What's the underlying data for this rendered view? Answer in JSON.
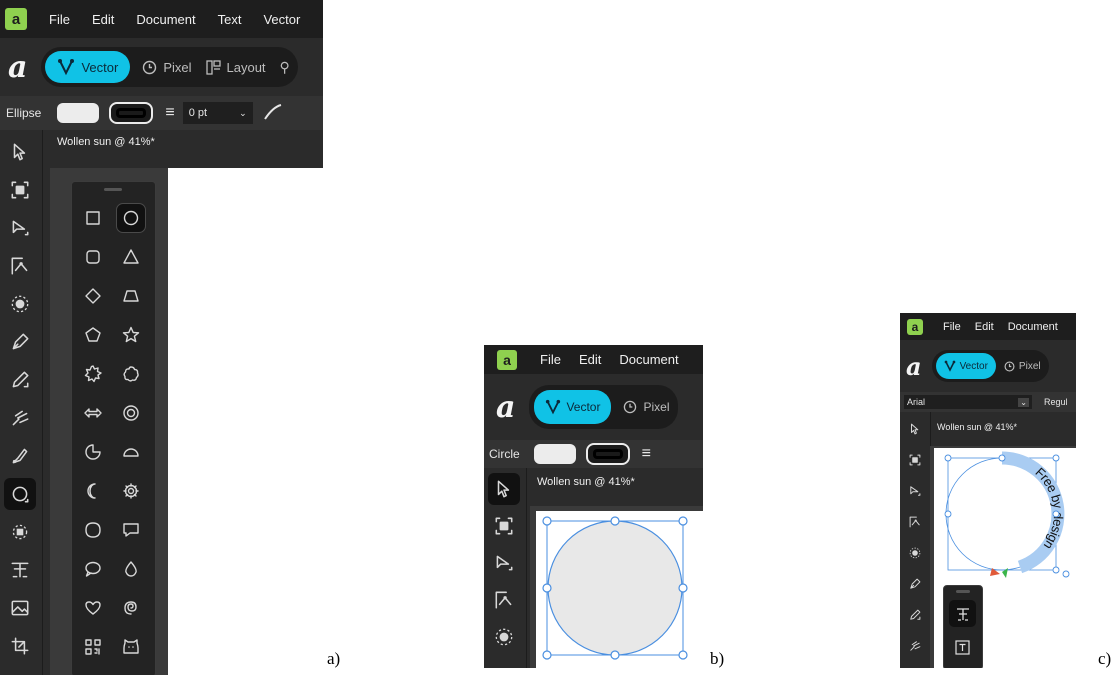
{
  "panel_a": {
    "menu": [
      "File",
      "Edit",
      "Document",
      "Text",
      "Vector"
    ],
    "personas": {
      "vector": "Vector",
      "pixel": "Pixel",
      "layout": "Layout"
    },
    "context_tool": "Ellipse",
    "stroke_width": "0 pt",
    "doc_title": "Wollen sun @ 41%*",
    "tools": [
      "move-icon",
      "frame-icon",
      "node-icon",
      "corner-icon",
      "fill-icon",
      "pen-icon",
      "pencil-icon",
      "brush-icon",
      "vector-brush-icon",
      "shape-icon",
      "transparency-icon",
      "artistic-text-icon",
      "image-icon",
      "crop-icon"
    ],
    "shapes": [
      "rectangle",
      "ellipse",
      "rounded-rectangle",
      "triangle",
      "diamond",
      "trapezoid",
      "polygon",
      "star",
      "cog",
      "cloud",
      "double-arrow",
      "donut",
      "pie",
      "segment",
      "crescent",
      "settings",
      "tear",
      "callout-square",
      "callout-round",
      "droplet",
      "heart",
      "spiral",
      "qr-code",
      "cat"
    ],
    "caption": "a)"
  },
  "panel_b": {
    "menu": [
      "File",
      "Edit",
      "Document"
    ],
    "personas": {
      "vector": "Vector",
      "pixel": "Pixel"
    },
    "context_tool": "Circle",
    "doc_title": "Wollen sun @ 41%*",
    "caption": "b)"
  },
  "panel_c": {
    "menu": [
      "File",
      "Edit",
      "Document"
    ],
    "personas": {
      "vector": "Vector",
      "pixel": "Pixel"
    },
    "font": "Arial",
    "font_style": "Regul",
    "doc_title": "Wollen sun @ 41%*",
    "path_text": "Free by design",
    "caption": "c)"
  },
  "colors": {
    "accent": "#10c2e6",
    "app_badge": "#8fd14f",
    "selection": "#4a8fe0",
    "circle_fill": "#e8e8e8"
  }
}
